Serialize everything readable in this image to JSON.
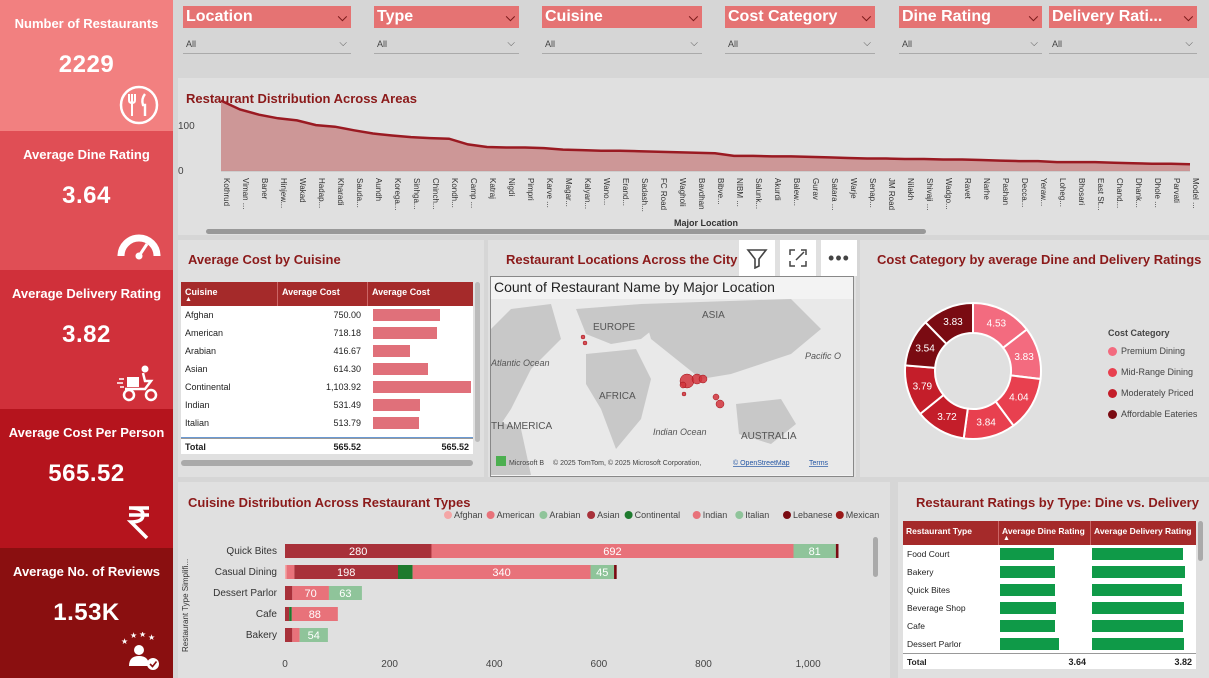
{
  "kpis": [
    {
      "title": "Number of Restaurants",
      "value": "2229",
      "icon": "restaurant-icon",
      "bg": "#f28080"
    },
    {
      "title": "Average Dine Rating",
      "value": "3.64",
      "icon": "gauge-icon",
      "bg": "#e04e55"
    },
    {
      "title": "Average Delivery Rating",
      "value": "3.82",
      "icon": "delivery-icon",
      "bg": "#d0303a"
    },
    {
      "title": "Average Cost Per Person",
      "value": "565.52",
      "icon": "rupee-icon",
      "bg": "#b5141d"
    },
    {
      "title": "Average No. of Reviews",
      "value": "1.53K",
      "icon": "reviews-icon",
      "bg": "#8a0f10"
    }
  ],
  "slicers": [
    {
      "label": "Location",
      "value": "All"
    },
    {
      "label": "Type",
      "value": "All"
    },
    {
      "label": "Cuisine",
      "value": "All"
    },
    {
      "label": "Cost Category",
      "value": "All"
    },
    {
      "label": "Dine Rating",
      "value": "All"
    },
    {
      "label": "Delivery Rati...",
      "value": "All"
    }
  ],
  "area_chart": {
    "title": "Restaurant Distribution Across Areas",
    "xlabel": "Major Location",
    "yticks": [
      "100",
      "0"
    ],
    "locations": [
      "Kothrud",
      "Viman ...",
      "Baner",
      "Hinjew...",
      "Wakad",
      "Hadap...",
      "Kharadi",
      "Sauda...",
      "Aundh",
      "Korega...",
      "Sinhga...",
      "Chinch...",
      "Kondh...",
      "Camp ...",
      "Katraj",
      "Nigdi",
      "Pimpri",
      "Karve ...",
      "Magar...",
      "Kalyan...",
      "Wano...",
      "Erand...",
      "Sadash...",
      "FC Road",
      "Wagholi",
      "Bavdhan",
      "Bibve...",
      "NIBM ...",
      "Salunk...",
      "Akurdi",
      "Balew...",
      "Gurav",
      "Satara ...",
      "Warje",
      "Senap...",
      "JM Road",
      "Nilakh",
      "Shivaji ...",
      "Wadgo...",
      "Ravet",
      "Narhe",
      "Pashan",
      "Decca...",
      "Yeraw...",
      "Loheg...",
      "Bhosari",
      "East St...",
      "Chand...",
      "Dhank...",
      "Dhole ...",
      "Parvati",
      "Model ..."
    ],
    "values": [
      135,
      118,
      108,
      101,
      97,
      88,
      85,
      78,
      72,
      68,
      65,
      63,
      62,
      51,
      46,
      45,
      45,
      44,
      41,
      40,
      39,
      39,
      38,
      37,
      36,
      35,
      34,
      29,
      29,
      28,
      28,
      27,
      26,
      25,
      24,
      24,
      23,
      23,
      22,
      22,
      21,
      20,
      19,
      19,
      17,
      17,
      17,
      16,
      15,
      14,
      14,
      13
    ]
  },
  "cost_table": {
    "title": "Average Cost by Cuisine",
    "headers": [
      "Cuisine",
      "Average Cost",
      "Average Cost"
    ],
    "rows": [
      {
        "cuisine": "Afghan",
        "cost": "750.00",
        "value": 750.0
      },
      {
        "cuisine": "American",
        "cost": "718.18",
        "value": 718.18
      },
      {
        "cuisine": "Arabian",
        "cost": "416.67",
        "value": 416.67
      },
      {
        "cuisine": "Asian",
        "cost": "614.30",
        "value": 614.3
      },
      {
        "cuisine": "Continental",
        "cost": "1,103.92",
        "value": 1103.92
      },
      {
        "cuisine": "Indian",
        "cost": "531.49",
        "value": 531.49
      },
      {
        "cuisine": "Italian",
        "cost": "513.79",
        "value": 513.79
      }
    ],
    "total_label": "Total",
    "total_cost": "565.52",
    "total_cost2": "565.52"
  },
  "map": {
    "title": "Restaurant Locations Across the City",
    "subtitle": "Count of Restaurant Name by Major Location",
    "labels": [
      "EUROPE",
      "ASIA",
      "AFRICA",
      "Atlantic Ocean",
      "Pacific O",
      "Indian Ocean",
      "AUSTRALIA",
      "TH AMERICA"
    ],
    "attribution": "Microsoft B",
    "copyright": "© 2025 TomTom, © 2025 Microsoft Corporation,",
    "osm": "© OpenStreetMap",
    "terms": "Terms"
  },
  "donut": {
    "title": "Cost Category by average Dine and Delivery Ratings",
    "legend_title": "Cost Category",
    "legend": [
      {
        "name": "Premium Dining",
        "color": "#f36b7f"
      },
      {
        "name": "Mid-Range Dining",
        "color": "#e8404f"
      },
      {
        "name": "Moderately Priced",
        "color": "#c41e2a"
      },
      {
        "name": "Affordable Eateries",
        "color": "#7a0b12"
      }
    ],
    "segments": [
      {
        "label": "4.53",
        "value": 4.53,
        "color": "#f36b7f"
      },
      {
        "label": "3.83",
        "value": 3.83,
        "color": "#f36b7f"
      },
      {
        "label": "4.04",
        "value": 4.04,
        "color": "#e8404f"
      },
      {
        "label": "3.84",
        "value": 3.84,
        "color": "#e8404f"
      },
      {
        "label": "3.72",
        "value": 3.72,
        "color": "#c41e2a"
      },
      {
        "label": "3.79",
        "value": 3.79,
        "color": "#c41e2a"
      },
      {
        "label": "3.54",
        "value": 3.54,
        "color": "#7a0b12"
      },
      {
        "label": "3.83",
        "value": 3.83,
        "color": "#7a0b12"
      }
    ]
  },
  "chart_data": {
    "type": "bar",
    "title": "Cuisine Distribution Across Restaurant Types",
    "ylabel": "Restaurant Type Simplifi...",
    "xlim": [
      0,
      1080
    ],
    "xticks": [
      "0",
      "200",
      "400",
      "600",
      "800",
      "1,000"
    ],
    "categories": [
      "Quick Bites",
      "Casual Dining",
      "Dessert Parlor",
      "Cafe",
      "Bakery"
    ],
    "series": [
      {
        "name": "Afghan",
        "color": "#f4a6a6",
        "values": [
          0,
          3,
          0,
          0,
          0
        ]
      },
      {
        "name": "American",
        "color": "#e8727a",
        "values": [
          0,
          15,
          0,
          0,
          0
        ]
      },
      {
        "name": "Arabian",
        "color": "#8fc49a",
        "values": [
          0,
          0,
          0,
          0,
          0
        ]
      },
      {
        "name": "Asian",
        "color": "#a8313a",
        "values": [
          280,
          198,
          14,
          8,
          14
        ]
      },
      {
        "name": "Continental",
        "color": "#1e7a2e",
        "values": [
          0,
          28,
          0,
          5,
          0
        ]
      },
      {
        "name": "Indian",
        "color": "#e8727a",
        "values": [
          692,
          340,
          70,
          88,
          14
        ]
      },
      {
        "name": "Italian",
        "color": "#8fc49a",
        "values": [
          81,
          45,
          63,
          0,
          54
        ]
      },
      {
        "name": "Lebanese",
        "color": "#7a0b12",
        "values": [
          5,
          5,
          0,
          0,
          0
        ]
      },
      {
        "name": "Mexican",
        "color": "#9a1a1a",
        "values": [
          0,
          0,
          0,
          0,
          0
        ]
      }
    ],
    "data_labels": [
      {
        "cat": 0,
        "series": 3,
        "text": "280"
      },
      {
        "cat": 0,
        "series": 5,
        "text": "692"
      },
      {
        "cat": 0,
        "series": 6,
        "text": "81"
      },
      {
        "cat": 1,
        "series": 3,
        "text": "198"
      },
      {
        "cat": 1,
        "series": 5,
        "text": "340"
      },
      {
        "cat": 1,
        "series": 6,
        "text": "45"
      },
      {
        "cat": 2,
        "series": 5,
        "text": "70"
      },
      {
        "cat": 2,
        "series": 6,
        "text": "63"
      },
      {
        "cat": 3,
        "series": 5,
        "text": "88"
      },
      {
        "cat": 4,
        "series": 6,
        "text": "54"
      }
    ]
  },
  "ratings_table": {
    "title": "Restaurant Ratings by Type: Dine vs. Delivery",
    "headers": [
      "Restaurant Type",
      "Average Dine Rating",
      "Average Delivery Rating"
    ],
    "rows": [
      {
        "type": "Food Court",
        "dine": 3.6,
        "delivery": 3.9
      },
      {
        "type": "Bakery",
        "dine": 3.65,
        "delivery": 3.98
      },
      {
        "type": "Quick Bites",
        "dine": 3.64,
        "delivery": 3.85
      },
      {
        "type": "Beverage Shop",
        "dine": 3.68,
        "delivery": 3.95
      },
      {
        "type": "Cafe",
        "dine": 3.62,
        "delivery": 3.9
      },
      {
        "type": "Dessert Parlor",
        "dine": 3.9,
        "delivery": 3.96
      }
    ],
    "total_label": "Total",
    "total_dine": "3.64",
    "total_delivery": "3.82",
    "bar_color": "#0f9a48"
  }
}
